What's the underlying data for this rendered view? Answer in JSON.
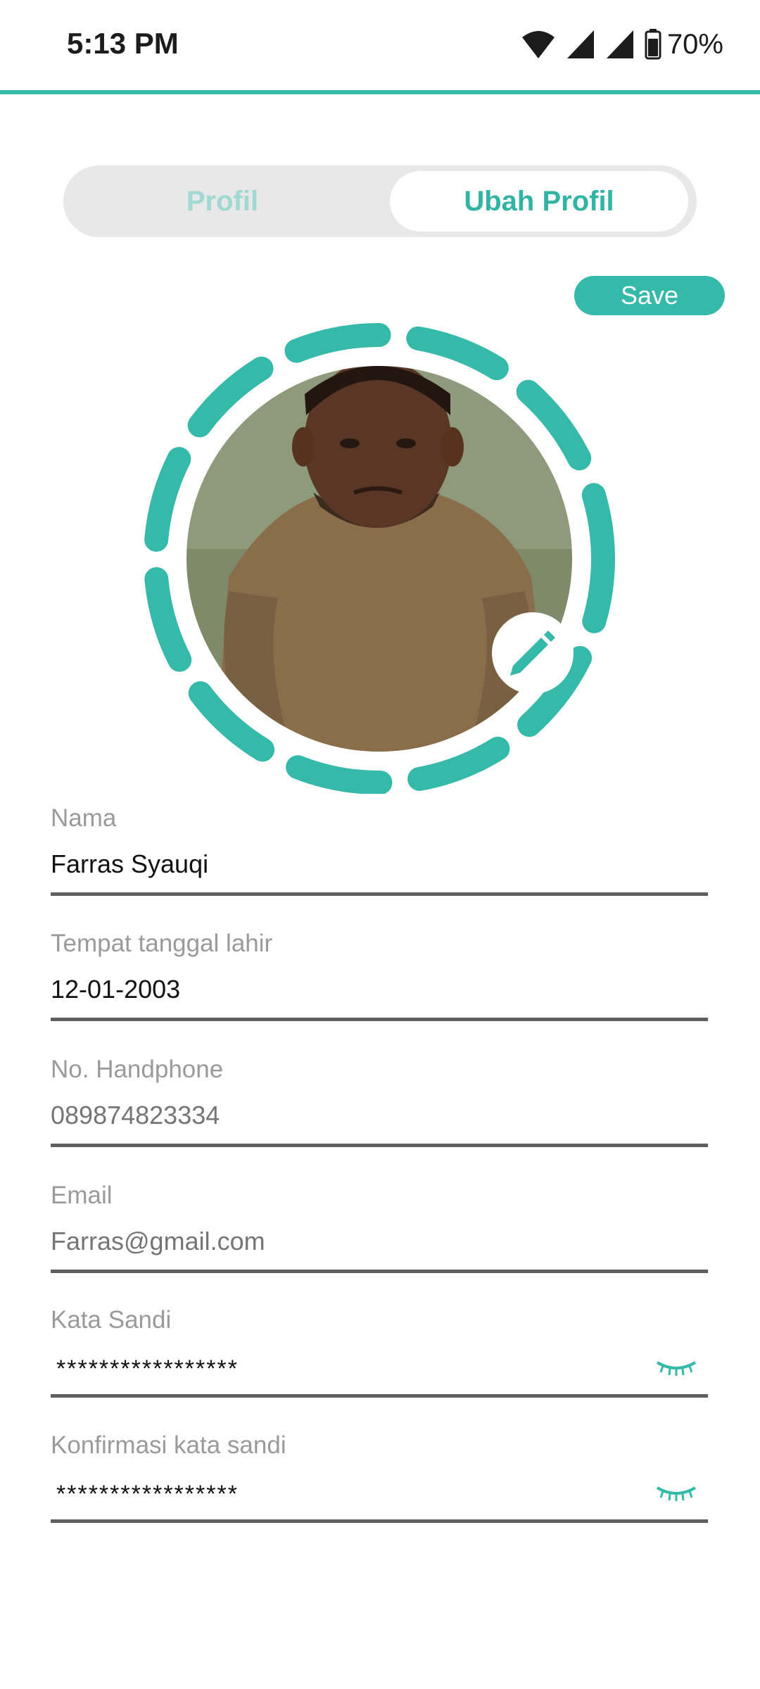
{
  "status_bar": {
    "time": "5:13 PM",
    "battery": "70%",
    "icons": [
      "wifi-icon",
      "cell-signal-icon",
      "cell-signal-icon",
      "battery-icon"
    ]
  },
  "tabs": {
    "profil": "Profil",
    "ubah_profil": "Ubah Profil",
    "active": "ubah_profil"
  },
  "save_label": "Save",
  "avatar": {
    "edit_icon": "pencil-icon"
  },
  "form": {
    "name": {
      "label": "Nama",
      "value": "Farras Syauqi"
    },
    "birth": {
      "label": "Tempat tanggal lahir",
      "value": "12-01-2003"
    },
    "phone": {
      "label": "No. Handphone",
      "placeholder": "089874823334"
    },
    "email": {
      "label": "Email",
      "placeholder": "Farras@gmail.com"
    },
    "password": {
      "label": "Kata Sandi",
      "value": "*****************"
    },
    "confirm_password": {
      "label": "Konfirmasi kata sandi",
      "value": "*****************"
    }
  },
  "colors": {
    "accent": "#35b9a9",
    "tab_inactive_text": "#9fd9d1",
    "label": "#9a9a9a",
    "underline": "#5f5f5f"
  }
}
